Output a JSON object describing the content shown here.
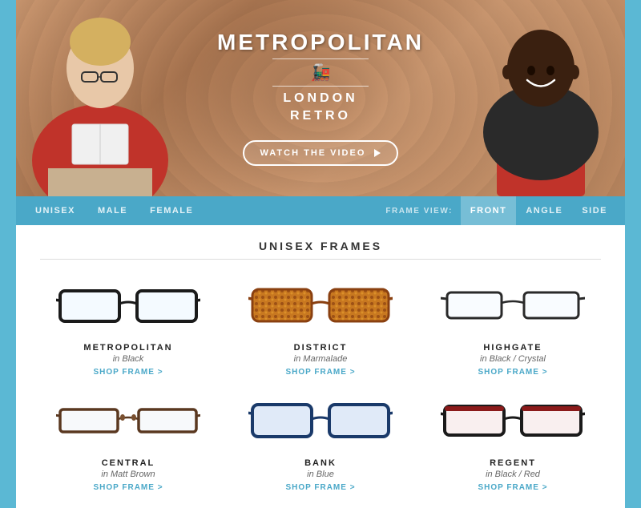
{
  "brand": {
    "title": "METROPOLITAN",
    "icon": "🚂",
    "line1": "LONDON",
    "line2": "RETRO"
  },
  "hero": {
    "watch_button": "WATCH THE VIDEO"
  },
  "nav": {
    "left_items": [
      {
        "label": "UNISEX",
        "active": true
      },
      {
        "label": "MALE",
        "active": false
      },
      {
        "label": "FEMALE",
        "active": false
      }
    ],
    "frame_view_label": "FRAME VIEW:",
    "right_items": [
      {
        "label": "FRONT",
        "active": true
      },
      {
        "label": "ANGLE",
        "active": false
      },
      {
        "label": "SIDE",
        "active": false
      }
    ]
  },
  "section": {
    "title": "UNISEX FRAMES"
  },
  "frames": [
    {
      "name": "METROPOLITAN",
      "color": "in Black",
      "shop_label": "SHOP FRAME >",
      "style": "metropolitan",
      "fill": "#1a1a1a",
      "lens": "transparent"
    },
    {
      "name": "DISTRICT",
      "color": "in Marmalade",
      "shop_label": "SHOP FRAME >",
      "style": "district",
      "fill": "#c87820",
      "lens": "#e8a030"
    },
    {
      "name": "HIGHGATE",
      "color": "in Black / Crystal",
      "shop_label": "SHOP FRAME >",
      "style": "highgate",
      "fill": "#2a2a2a",
      "lens": "transparent"
    },
    {
      "name": "CENTRAL",
      "color": "in Matt Brown",
      "shop_label": "SHOP FRAME >",
      "style": "central",
      "fill": "#5a3820",
      "lens": "transparent"
    },
    {
      "name": "BANK",
      "color": "in Blue",
      "shop_label": "SHOP FRAME >",
      "style": "bank",
      "fill": "#1a3a6a",
      "lens": "transparent"
    },
    {
      "name": "REGENT",
      "color": "in Black / Red",
      "shop_label": "SHOP FRAME >",
      "style": "regent",
      "fill": "#1a1a1a",
      "lens": "transparent"
    }
  ]
}
